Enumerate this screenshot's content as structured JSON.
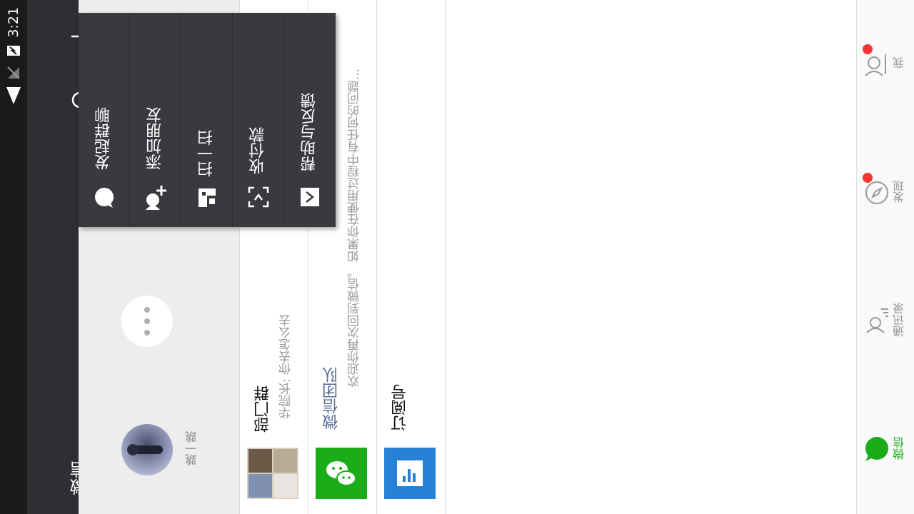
{
  "status_bar": {
    "time": "3:21"
  },
  "title_bar": {
    "title": "微信"
  },
  "story": {
    "user_name": "跳一跳"
  },
  "chats": [
    {
      "name": "部门群",
      "preview": "华院长: 你去怎么去"
    },
    {
      "name": "微信团队",
      "preview": "欢迎你再次回到微信。 如果你在使用过程中有任何的问题..."
    },
    {
      "name": "订阅号",
      "preview": ""
    }
  ],
  "menu": {
    "items": [
      {
        "label": "发起群聊",
        "icon": "chat-bubble-icon"
      },
      {
        "label": "添加朋友",
        "icon": "add-friend-icon"
      },
      {
        "label": "扫一扫",
        "icon": "scan-icon"
      },
      {
        "label": "收付款",
        "icon": "payment-icon"
      },
      {
        "label": "帮助与反馈",
        "icon": "feedback-icon"
      }
    ]
  },
  "tabs": [
    {
      "label": "微信",
      "active": true
    },
    {
      "label": "通讯录",
      "active": false
    },
    {
      "label": "发现",
      "active": false,
      "badge": true
    },
    {
      "label": "我",
      "active": false,
      "badge": true
    }
  ],
  "colors": {
    "accent": "#1aad19",
    "header": "#2e2f32",
    "menu": "#393a3f",
    "badge": "#f43530",
    "link": "#576b95",
    "subscribe": "#2782d7"
  }
}
